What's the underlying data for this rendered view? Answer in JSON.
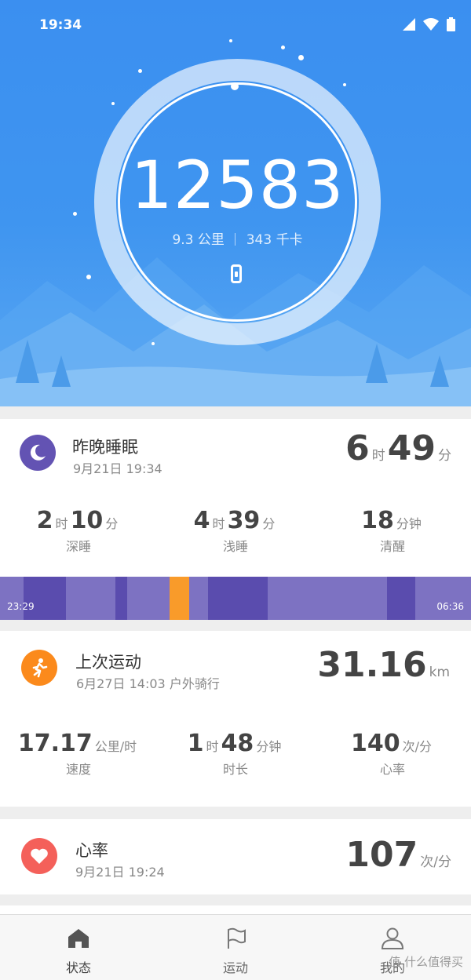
{
  "status_bar": {
    "time": "19:34"
  },
  "hero": {
    "steps": "12583",
    "distance_value": "9.3",
    "distance_unit": "公里",
    "calories_value": "343",
    "calories_unit": "千卡"
  },
  "sleep": {
    "title": "昨晚睡眠",
    "date": "9月21日 19:34",
    "total_hours": "6",
    "total_minutes": "49",
    "hour_unit": "时",
    "minute_unit": "分",
    "deep": {
      "hours": "2",
      "minutes": "10",
      "label": "深睡"
    },
    "light": {
      "hours": "4",
      "minutes": "39",
      "label": "浅睡"
    },
    "awake": {
      "minutes": "18",
      "unit": "分钟",
      "label": "清醒"
    },
    "bar_start": "23:29",
    "bar_end": "06:36",
    "colors": {
      "light": "#7d72c2",
      "deep": "#5a4cae",
      "awake": "#f99b2a"
    }
  },
  "exercise": {
    "title": "上次运动",
    "subtitle": "6月27日 14:03 户外骑行",
    "distance": "31.16",
    "distance_unit": "km",
    "speed": {
      "value": "17.17",
      "unit": "公里/时",
      "label": "速度"
    },
    "duration": {
      "hours": "1",
      "hour_unit": "时",
      "minutes": "48",
      "minute_unit": "分钟",
      "label": "时长"
    },
    "heart": {
      "value": "140",
      "unit": "次/分",
      "label": "心率"
    },
    "color": "#fb8a1c"
  },
  "heart_rate": {
    "title": "心率",
    "date": "9月21日 19:24",
    "value": "107",
    "unit": "次/分",
    "color": "#f4605a"
  },
  "tabs": [
    {
      "label": "状态",
      "icon": "home-icon"
    },
    {
      "label": "运动",
      "icon": "flag-icon"
    },
    {
      "label": "我的",
      "icon": "person-icon"
    }
  ],
  "watermark": "值 什么值得买"
}
